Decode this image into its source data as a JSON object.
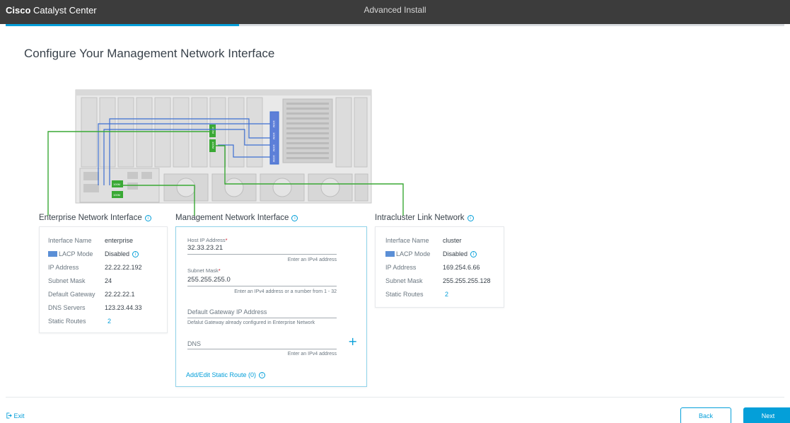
{
  "header": {
    "brand_bold": "Cisco",
    "brand_rest": "Catalyst Center",
    "wizard_title": "Advanced Install",
    "progress_percent": 30
  },
  "page_title": "Configure Your Management Network Interface",
  "server_ports": [
    "100M",
    "100M",
    "100M",
    "100M",
    "100M",
    "100M",
    "100M",
    "100M"
  ],
  "enterprise": {
    "title": "Enterprise Network Interface",
    "rows": [
      {
        "key": "Interface Name",
        "value": "enterprise"
      },
      {
        "key": "LACP Mode",
        "value": "Disabled"
      },
      {
        "key": "IP Address",
        "value": "22.22.22.192"
      },
      {
        "key": "Subnet Mask",
        "value": "24"
      },
      {
        "key": "Default Gateway",
        "value": "22.22.22.1"
      },
      {
        "key": "DNS Servers",
        "value": "123.23.44.33"
      },
      {
        "key": "Static Routes",
        "value": "2"
      }
    ]
  },
  "management": {
    "title": "Management Network Interface",
    "host_ip_label": "Host IP Address",
    "host_ip_value": "32.33.23.21",
    "host_ip_hint": "Enter an IPv4 address",
    "subnet_label": "Subnet Mask",
    "subnet_value": "255.255.255.0",
    "subnet_hint": "Enter an IPv4 address or a number from 1 - 32",
    "gateway_label": "Default Gateway IP Address",
    "gateway_hint": "Defalut Gateway already configured in Enterprise Network",
    "dns_label": "DNS",
    "dns_hint": "Enter an IPv4 address",
    "static_route_link": "Add/Edit Static Route (0)"
  },
  "intracluster": {
    "title": "Intracluster Link Network",
    "rows": [
      {
        "key": "Interface Name",
        "value": "cluster"
      },
      {
        "key": "LACP Mode",
        "value": "Disabled"
      },
      {
        "key": "IP Address",
        "value": "169.254.6.66"
      },
      {
        "key": "Subnet Mask",
        "value": "255.255.255.128"
      },
      {
        "key": "Static Routes",
        "value": "2"
      }
    ]
  },
  "footer": {
    "exit_label": "Exit",
    "back_label": "Back",
    "next_label": "Next"
  },
  "colors": {
    "accent": "#049fd9",
    "topbar": "#3c3c3c",
    "link_green": "#3aa935",
    "link_blue": "#3d6fd1"
  }
}
